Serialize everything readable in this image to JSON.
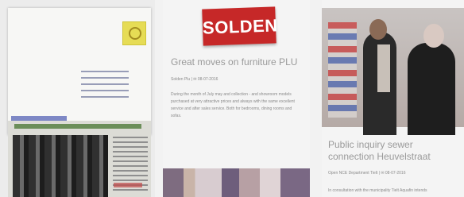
{
  "articles": [
    {
      "image": "scanned-letter-and-newspaper-clipping"
    },
    {
      "logo_text": "SOLDEN",
      "title": "Great moves on furniture PLU",
      "meta": "Solden Plu   |   ✉ 08-07-2016",
      "body": "During the month of July may and collection - and showroom models purchased at very attractive prices and always with the same excellent service and after sales service. Both for bedrooms, dining rooms and sofas."
    },
    {
      "image": "people-talking-in-office",
      "title": "Public inquiry sewer connection Heuvelstraat",
      "meta": "Open NCE Department Tielt   |   ✉ 08-07-2016",
      "body": "In consultation with the municipality Tielt Aquafin intends"
    }
  ]
}
